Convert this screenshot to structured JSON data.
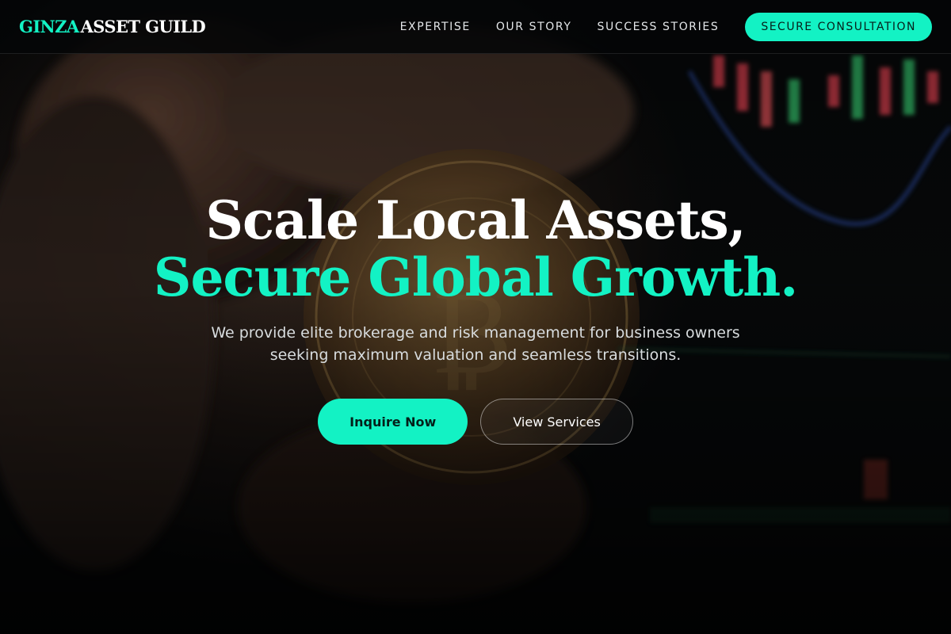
{
  "brand": {
    "logo_accent": "GINZA",
    "logo_main": "ASSET GUILD",
    "accent_color": "#13f2c4"
  },
  "nav": {
    "links": [
      "EXPERTISE",
      "OUR STORY",
      "SUCCESS STORIES"
    ],
    "cta_label": "SECURE CONSULTATION"
  },
  "hero": {
    "headline_line1": "Scale Local Assets,",
    "headline_line2": "Secure Global Growth.",
    "subtext": "We provide elite brokerage and risk management for business owners seeking maximum valuation and seamless transitions.",
    "primary_button": "Inquire Now",
    "secondary_button": "View Services",
    "background": "hand-holding-bitcoin-photo"
  }
}
